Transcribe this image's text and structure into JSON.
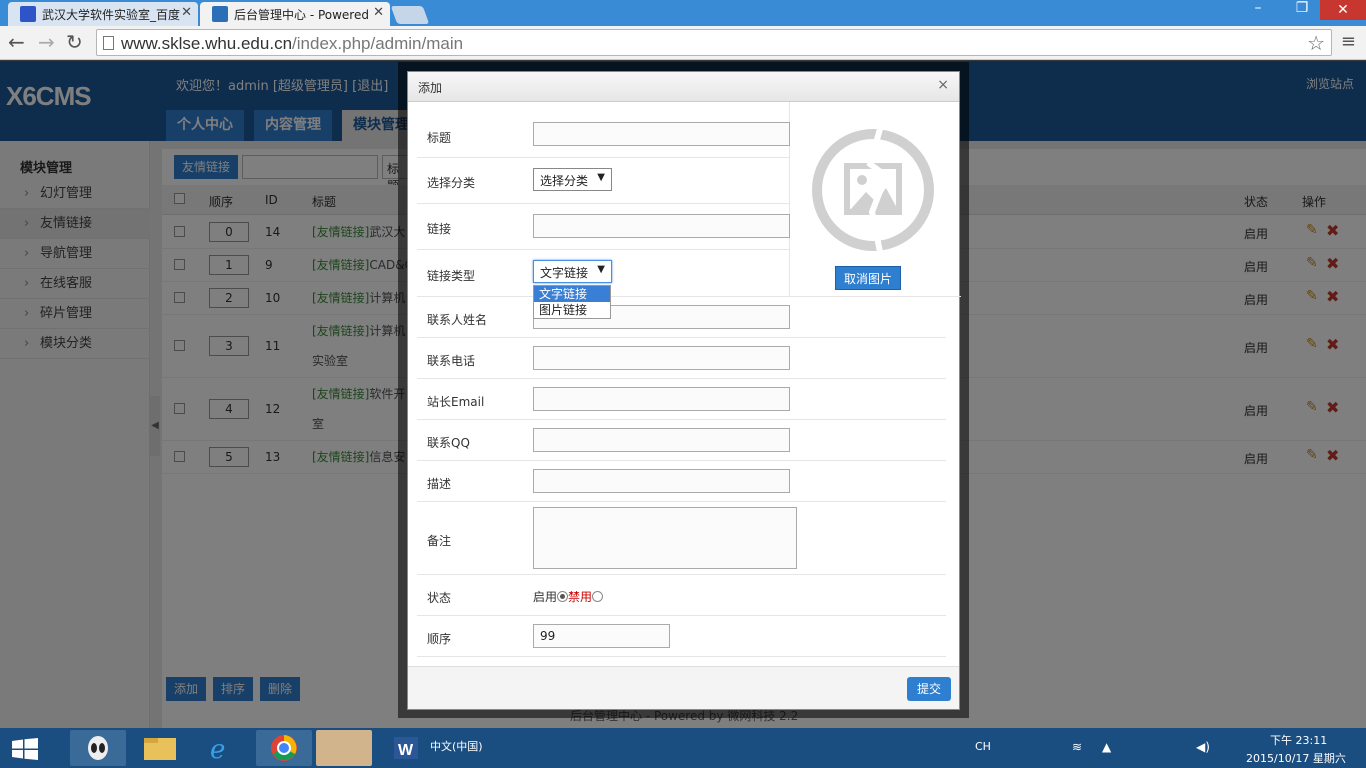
{
  "browser": {
    "tabs": [
      {
        "label": "武汉大学软件实验室_百度"
      },
      {
        "label": "后台管理中心 - Powered"
      }
    ],
    "url_host": "www.sklse.whu.edu.cn",
    "url_path": "/index.php/admin/main"
  },
  "header": {
    "logo": "X6CMS",
    "welcome": "欢迎您！admin [超级管理员] [退出]",
    "browse": "浏览站点",
    "nav": [
      "个人中心",
      "内容管理",
      "模块管理"
    ]
  },
  "sidebar": {
    "title": "模块管理",
    "items": [
      "幻灯管理",
      "友情链接",
      "导航管理",
      "在线客服",
      "碎片管理",
      "模块分类"
    ]
  },
  "list": {
    "filter_button": "友情链接",
    "filter_label": "标题",
    "columns": {
      "order": "顺序",
      "id": "ID",
      "title": "标题",
      "status": "状态",
      "actions": "操作"
    },
    "rows": [
      {
        "order": "0",
        "id": "14",
        "tag": "[友情链接]",
        "title": "武汉大",
        "status": "启用"
      },
      {
        "order": "1",
        "id": "9",
        "tag": "[友情链接]",
        "title": "CAD&C",
        "status": "启用"
      },
      {
        "order": "2",
        "id": "10",
        "tag": "[友情链接]",
        "title": "计算机",
        "status": "启用"
      },
      {
        "order": "3",
        "id": "11",
        "tag": "[友情链接]",
        "title": "计算机",
        "title2": "实验室",
        "status": "启用"
      },
      {
        "order": "4",
        "id": "12",
        "tag": "[友情链接]",
        "title": "软件开",
        "title2": "室",
        "status": "启用"
      },
      {
        "order": "5",
        "id": "13",
        "tag": "[友情链接]",
        "title": "信息安",
        "status": "启用"
      }
    ],
    "bottom_buttons": [
      "添加",
      "排序",
      "删除"
    ],
    "footer": "后台管理中心 - Powered by 微网科技 2.2"
  },
  "modal": {
    "title": "添加",
    "close": "×",
    "fields": {
      "title_label": "标题",
      "category_label": "选择分类",
      "category_value": "选择分类",
      "link_label": "链接",
      "link_type_label": "链接类型",
      "link_type_value": "文字链接",
      "link_type_options": [
        "文字链接",
        "图片链接"
      ],
      "contact_name_label": "联系人姓名",
      "phone_label": "联系电话",
      "email_label": "站长Email",
      "qq_label": "联系QQ",
      "desc_label": "描述",
      "remark_label": "备注",
      "status_label": "状态",
      "status_on": "启用",
      "status_off": "禁用",
      "order_label": "顺序",
      "order_value": "99"
    },
    "cancel_image": "取消图片",
    "submit": "提交"
  },
  "taskbar": {
    "lang": "CH",
    "time": "下午 23:11",
    "date": "2015/10/17 星期六",
    "ime": "中文(中国)"
  }
}
